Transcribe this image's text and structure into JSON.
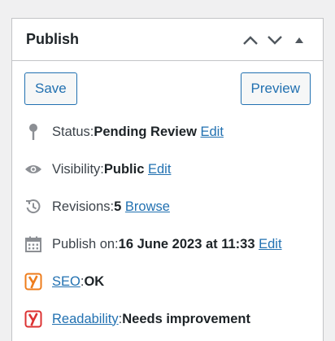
{
  "panel": {
    "title": "Publish"
  },
  "actions": {
    "save_label": "Save",
    "preview_label": "Preview"
  },
  "status": {
    "label": "Status: ",
    "value": "Pending Review",
    "edit_link": "Edit"
  },
  "visibility": {
    "label": "Visibility: ",
    "value": "Public",
    "edit_link": "Edit"
  },
  "revisions": {
    "label": "Revisions: ",
    "value": "5",
    "browse_link": "Browse"
  },
  "schedule": {
    "label": "Publish on: ",
    "value": "16 June 2023 at 11:33",
    "edit_link": "Edit"
  },
  "seo": {
    "link": "SEO",
    "separator": ": ",
    "value": "OK"
  },
  "readability": {
    "link": "Readability",
    "separator": ": ",
    "value": "Needs improvement"
  },
  "colors": {
    "link": "#2271b1",
    "seo_ok": "#ee7c1b",
    "readability_bad": "#dc3232",
    "icon": "#8c8f94"
  },
  "icons": {
    "move_up": "chevron-up-icon",
    "move_down": "chevron-down-icon",
    "toggle": "triangle-up-icon",
    "status": "pin-icon",
    "visibility": "eye-icon",
    "revisions": "history-icon",
    "schedule": "calendar-icon",
    "seo": "yoast-icon",
    "readability": "yoast-icon"
  }
}
